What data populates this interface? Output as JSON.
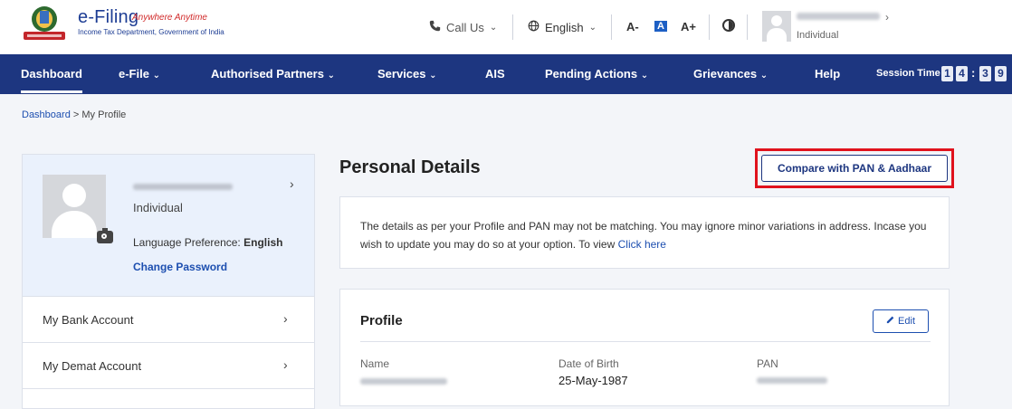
{
  "header": {
    "logo_title": "e-Filing",
    "logo_tagline": "Anywhere Anytime",
    "logo_subtitle": "Income Tax Department, Government of India",
    "call_us": "Call Us",
    "language": "English",
    "font_decrease": "A-",
    "font_normal": "A",
    "font_increase": "A+",
    "user_role": "Individual"
  },
  "nav": {
    "items": [
      "Dashboard",
      "e-File",
      "Authorised Partners",
      "Services",
      "AIS",
      "Pending Actions",
      "Grievances",
      "Help"
    ],
    "session_label": "Session Time",
    "session_digits": [
      "1",
      "4",
      "3",
      "9"
    ]
  },
  "breadcrumb": {
    "home": "Dashboard",
    "separator": ">",
    "current": "My Profile"
  },
  "profile_panel": {
    "role": "Individual",
    "language_label": "Language Preference:",
    "language_value": "English",
    "change_password": "Change Password",
    "menu": [
      "My Bank Account",
      "My Demat Account"
    ]
  },
  "main": {
    "title": "Personal Details",
    "compare_button": "Compare with PAN & Aadhaar",
    "notice_text": "The details as per your Profile and PAN may not be matching. You may ignore minor variations in address. Incase you wish to update you may do so at your option. To view",
    "notice_link": "Click here",
    "profile_heading": "Profile",
    "edit_button": "Edit",
    "fields": [
      {
        "label": "Name",
        "value": ""
      },
      {
        "label": "Date of Birth",
        "value": "25-May-1987"
      },
      {
        "label": "PAN",
        "value": ""
      }
    ]
  },
  "colors": {
    "nav_bg": "#1d3680",
    "accent": "#1d4fb0",
    "highlight": "#e0121d"
  },
  "icons": [
    "emblem-icon",
    "phone-icon",
    "globe-icon",
    "chevron-down-icon",
    "contrast-icon",
    "avatar-icon",
    "camera-icon",
    "chevron-right-icon",
    "pencil-icon"
  ]
}
